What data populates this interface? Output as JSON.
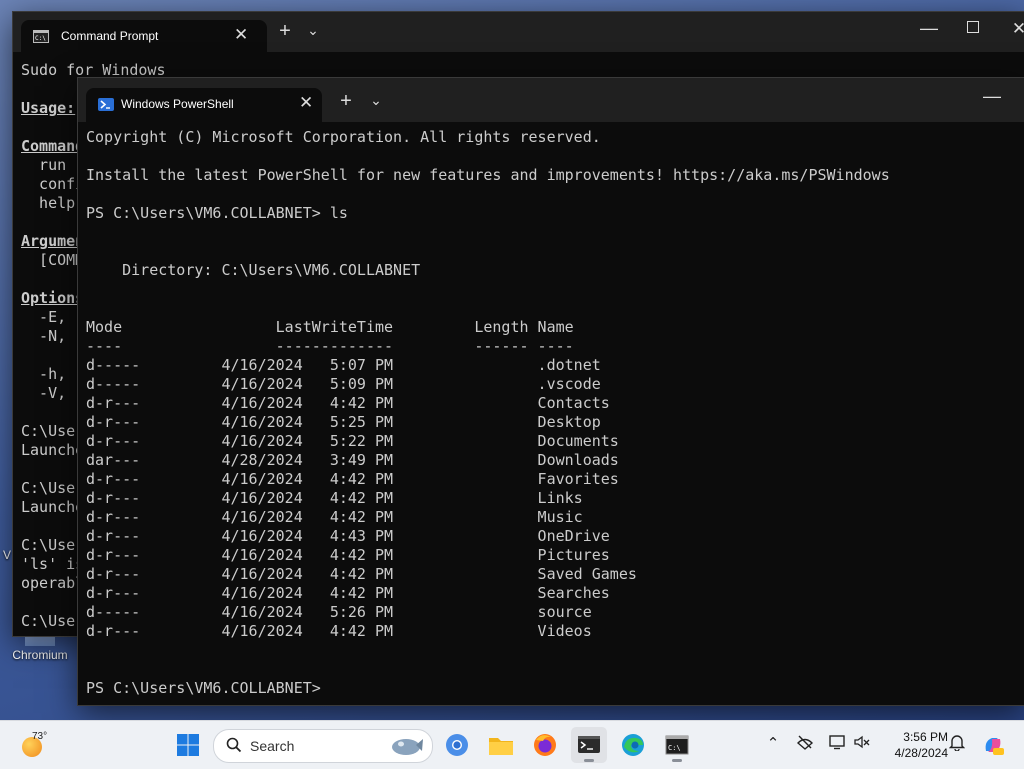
{
  "desktop": {
    "icon_label": "Chromium",
    "partial_letter": "V"
  },
  "cmd_window": {
    "tab_title": "Command Prompt",
    "lines": [
      {
        "text": "Sudo for Windows",
        "style": ""
      },
      {
        "text": "",
        "style": ""
      },
      {
        "text": "Usage:",
        "style": "ul"
      },
      {
        "text": "",
        "style": ""
      },
      {
        "text": "Command",
        "style": "ul"
      },
      {
        "text": "  run",
        "style": ""
      },
      {
        "text": "  confi",
        "style": ""
      },
      {
        "text": "  help",
        "style": ""
      },
      {
        "text": "",
        "style": ""
      },
      {
        "text": "Argumen",
        "style": "ul"
      },
      {
        "text": "  [COMM",
        "style": ""
      },
      {
        "text": "",
        "style": ""
      },
      {
        "text": "Options",
        "style": "ul"
      },
      {
        "text": "  -E, -",
        "style": ""
      },
      {
        "text": "  -N, -",
        "style": ""
      },
      {
        "text": "      -",
        "style": ""
      },
      {
        "text": "  -h, -",
        "style": ""
      },
      {
        "text": "  -V, -",
        "style": ""
      },
      {
        "text": "",
        "style": ""
      },
      {
        "text": "C:\\User",
        "style": ""
      },
      {
        "text": "Launche",
        "style": ""
      },
      {
        "text": "",
        "style": ""
      },
      {
        "text": "C:\\User",
        "style": ""
      },
      {
        "text": "Launche",
        "style": ""
      },
      {
        "text": "",
        "style": ""
      },
      {
        "text": "C:\\User",
        "style": ""
      },
      {
        "text": "'ls' is",
        "style": ""
      },
      {
        "text": "operabl",
        "style": ""
      },
      {
        "text": "",
        "style": ""
      },
      {
        "text": "C:\\User",
        "style": ""
      }
    ]
  },
  "ps_window": {
    "tab_title": "Windows PowerShell",
    "lines": [
      "Copyright (C) Microsoft Corporation. All rights reserved.",
      "",
      "Install the latest PowerShell for new features and improvements! https://aka.ms/PSWindows",
      "",
      "PS C:\\Users\\VM6.COLLABNET> ls",
      "",
      "",
      "    Directory: C:\\Users\\VM6.COLLABNET",
      "",
      "",
      "Mode                 LastWriteTime         Length Name",
      "----                 -------------         ------ ----",
      "d-----         4/16/2024   5:07 PM                .dotnet",
      "d-----         4/16/2024   5:09 PM                .vscode",
      "d-r---         4/16/2024   4:42 PM                Contacts",
      "d-r---         4/16/2024   5:25 PM                Desktop",
      "d-r---         4/16/2024   5:22 PM                Documents",
      "dar---         4/28/2024   3:49 PM                Downloads",
      "d-r---         4/16/2024   4:42 PM                Favorites",
      "d-r---         4/16/2024   4:42 PM                Links",
      "d-r---         4/16/2024   4:42 PM                Music",
      "d-r---         4/16/2024   4:43 PM                OneDrive",
      "d-r---         4/16/2024   4:42 PM                Pictures",
      "d-r---         4/16/2024   4:42 PM                Saved Games",
      "d-r---         4/16/2024   4:42 PM                Searches",
      "d-----         4/16/2024   5:26 PM                source",
      "d-r---         4/16/2024   4:42 PM                Videos",
      "",
      "",
      "PS C:\\Users\\VM6.COLLABNET> "
    ]
  },
  "taskbar": {
    "weather_temp": "73°",
    "search_label": "Search",
    "time": "3:56 PM",
    "date": "4/28/2024"
  },
  "colors": {
    "terminal_bg": "#0c0c0c",
    "terminal_fg": "#cccccc",
    "titlebar_bg": "#202020",
    "taskbar_bg": "#eef1f5",
    "ps_icon": "#2a6fd6"
  }
}
